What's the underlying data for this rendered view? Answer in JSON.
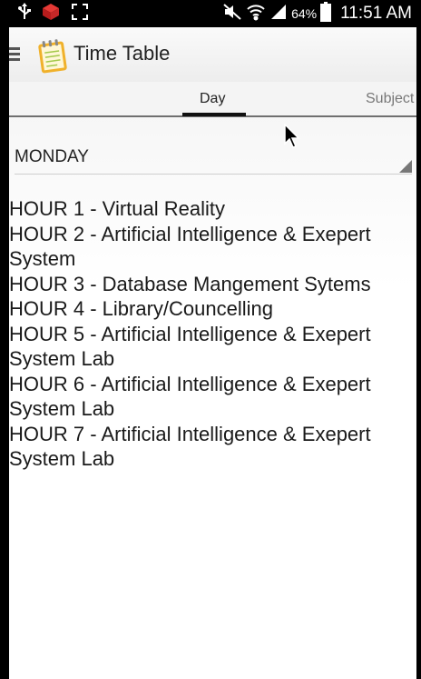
{
  "status_bar": {
    "battery_percent": "64%",
    "time": "11:51 AM"
  },
  "app": {
    "title": "Time Table"
  },
  "tabs": [
    {
      "label": "Day",
      "selected": true
    },
    {
      "label": "Subject",
      "selected": false
    }
  ],
  "day_selector": {
    "selected": "MONDAY"
  },
  "schedule": [
    "HOUR 1 - Virtual Reality",
    "HOUR 2 - Artificial Intelligence & Exepert System",
    "HOUR 3 - Database Mangement Sytems",
    "HOUR 4 - Library/Councelling",
    "HOUR 5 - Artificial Intelligence & Exepert System Lab",
    "HOUR 6 - Artificial Intelligence & Exepert System Lab",
    "HOUR 7 - Artificial Intelligence & Exepert System Lab"
  ]
}
